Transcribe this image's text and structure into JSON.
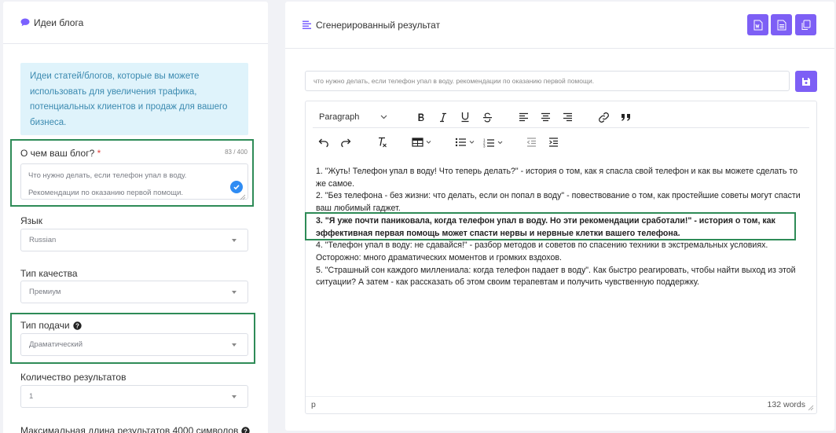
{
  "left": {
    "header_title": "Идеи блога",
    "info_text": "Идеи статей/блогов, которые вы можете использовать для увеличения трафика, потенциальных клиентов и продаж для вашего бизнеса.",
    "topic_label": "О чем ваш блог?",
    "required_mark": "*",
    "topic_counter": "83 / 400",
    "topic_line1": "Что нужно делать, если телефон упал в воду.",
    "topic_line2": "Рекомендации по оказанию первой помощи.",
    "language_label": "Язык",
    "language_value": "Russian",
    "quality_label": "Тип качества",
    "quality_value": "Премиум",
    "tone_label": "Тип подачи",
    "tone_value": "Драматический",
    "count_label": "Количество результатов",
    "count_value": "1",
    "maxlen_label": "Максимальная длина результатов 4000 символов"
  },
  "right": {
    "header_title": "Сгенерированный результат",
    "prompt_value": "что нужно делать, если телефон упал в воду. рекомендации по оказанию первой помощи.",
    "paragraph_label": "Paragraph",
    "results": [
      "1. \"Жуть! Телефон упал в воду! Что теперь делать?\" - история о том, как я спасла свой телефон и как вы можете сделать то же самое.",
      "2. \"Без телефона - без жизни: что делать, если он попал в воду\" - повествование о том, как простейшие советы могут спасти ваш любимый гаджет.",
      "3. \"Я уже почти паниковала, когда телефон упал в воду. Но эти рекомендации сработали!\" - история о том, как эффективная первая помощь может спасти нервы и нервные клетки вашего телефона.",
      "4. \"Телефон упал в воду: не сдавайся!\" - разбор методов и советов по спасению техники в экстремальных условиях. Осторожно: много драматических моментов и громких вздохов.",
      "5. \"Страшный сон каждого миллениала: когда телефон падает в воду\". Как быстро реагировать, чтобы найти выход из этой ситуации? А затем - как рассказать об этом своим терапевтам и получить чувственную поддержку."
    ],
    "status_path": "p",
    "word_count": "132 words"
  },
  "colors": {
    "accent": "#7d5ff5",
    "highlight_border": "#2e8b57",
    "info_bg": "#dff3fb",
    "info_text": "#3b8ab0",
    "check": "#2f8cf3"
  }
}
